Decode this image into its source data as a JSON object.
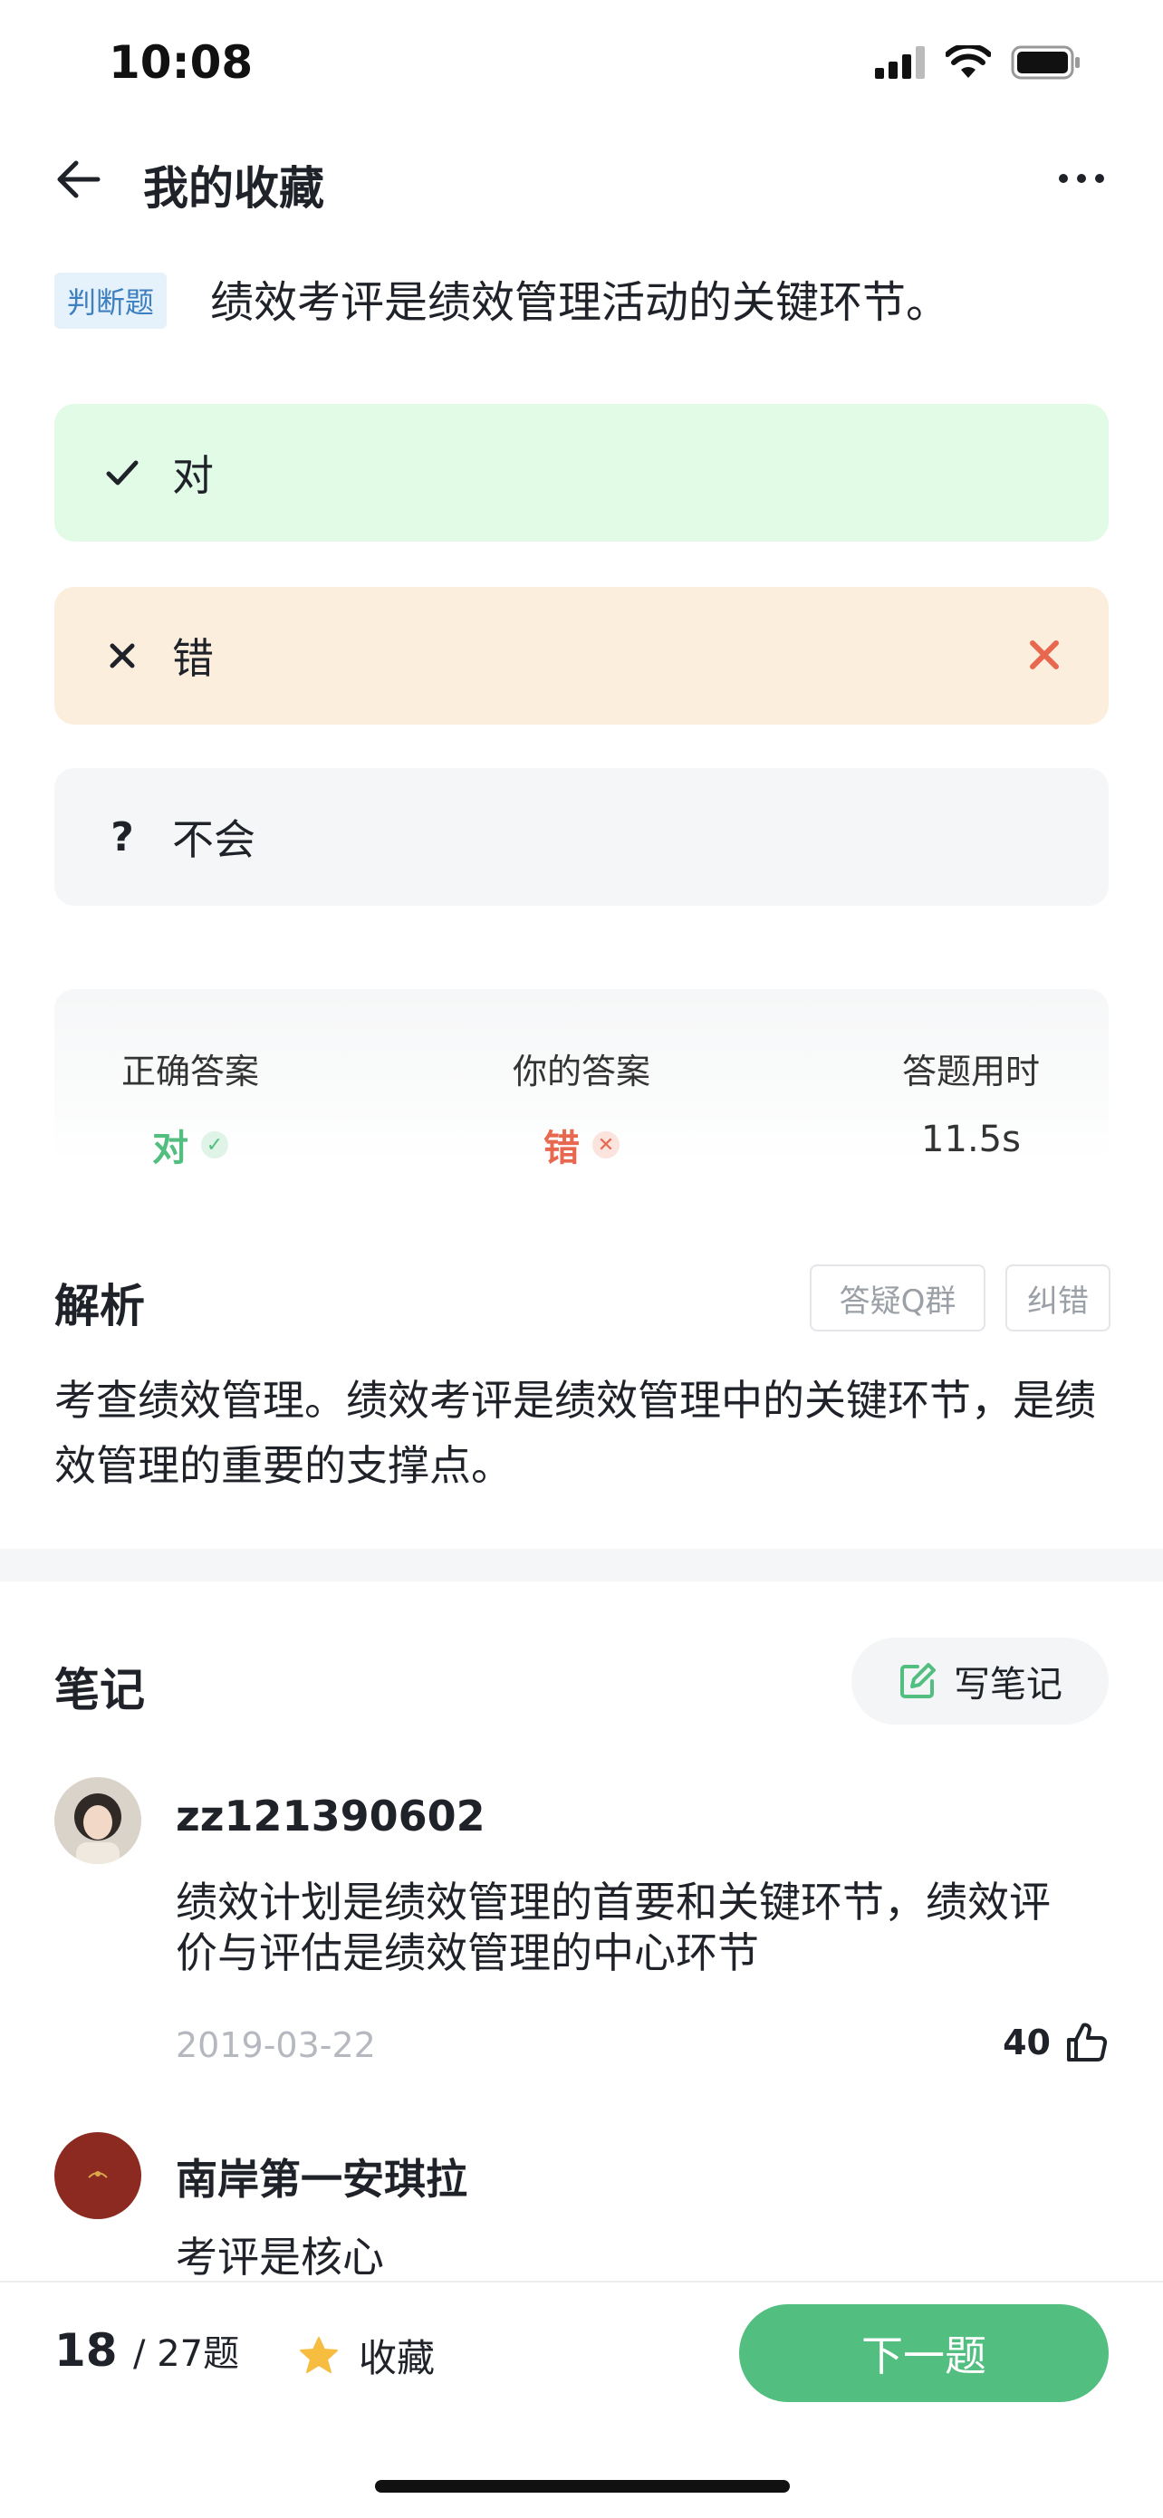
{
  "status_bar": {
    "time": "10:08"
  },
  "nav": {
    "title": "我的收藏"
  },
  "question": {
    "type_tag": "判断题",
    "text": "绩效考评是绩效管理活动的关键环节。",
    "options": [
      {
        "icon": "check-icon",
        "label": "对"
      },
      {
        "icon": "cross-icon",
        "label": "错"
      },
      {
        "icon": "question-icon",
        "label": "不会"
      }
    ]
  },
  "stats": {
    "correct_header": "正确答案",
    "correct_value": "对",
    "yours_header": "你的答案",
    "yours_value": "错",
    "time_header": "答题用时",
    "time_value": "11.5s"
  },
  "analysis": {
    "title": "解析",
    "qq_group_button": "答疑Q群",
    "report_button": "纠错",
    "text": "考查绩效管理。绩效考评是绩效管理中的关键环节，是绩效管理的重要的支撑点。"
  },
  "notes": {
    "title": "笔记",
    "write_button": "写笔记",
    "items": [
      {
        "user": "zz121390602",
        "text": "绩效计划是绩效管理的首要和关键环节，绩效评价与评估是绩效管理的中心环节",
        "date": "2019-03-22",
        "likes": "40"
      },
      {
        "user": "南岸第一安琪拉",
        "text": "考评是核心"
      }
    ]
  },
  "bottom": {
    "current": "18",
    "total": "/ 27题",
    "favorite": "收藏",
    "next_button": "下一题"
  },
  "colors": {
    "correct_green": "#52be80",
    "wrong_red": "#e8674f",
    "correct_bg": "#e2fbe6",
    "wrong_bg": "#fbeedd",
    "star": "#f6bd41"
  }
}
